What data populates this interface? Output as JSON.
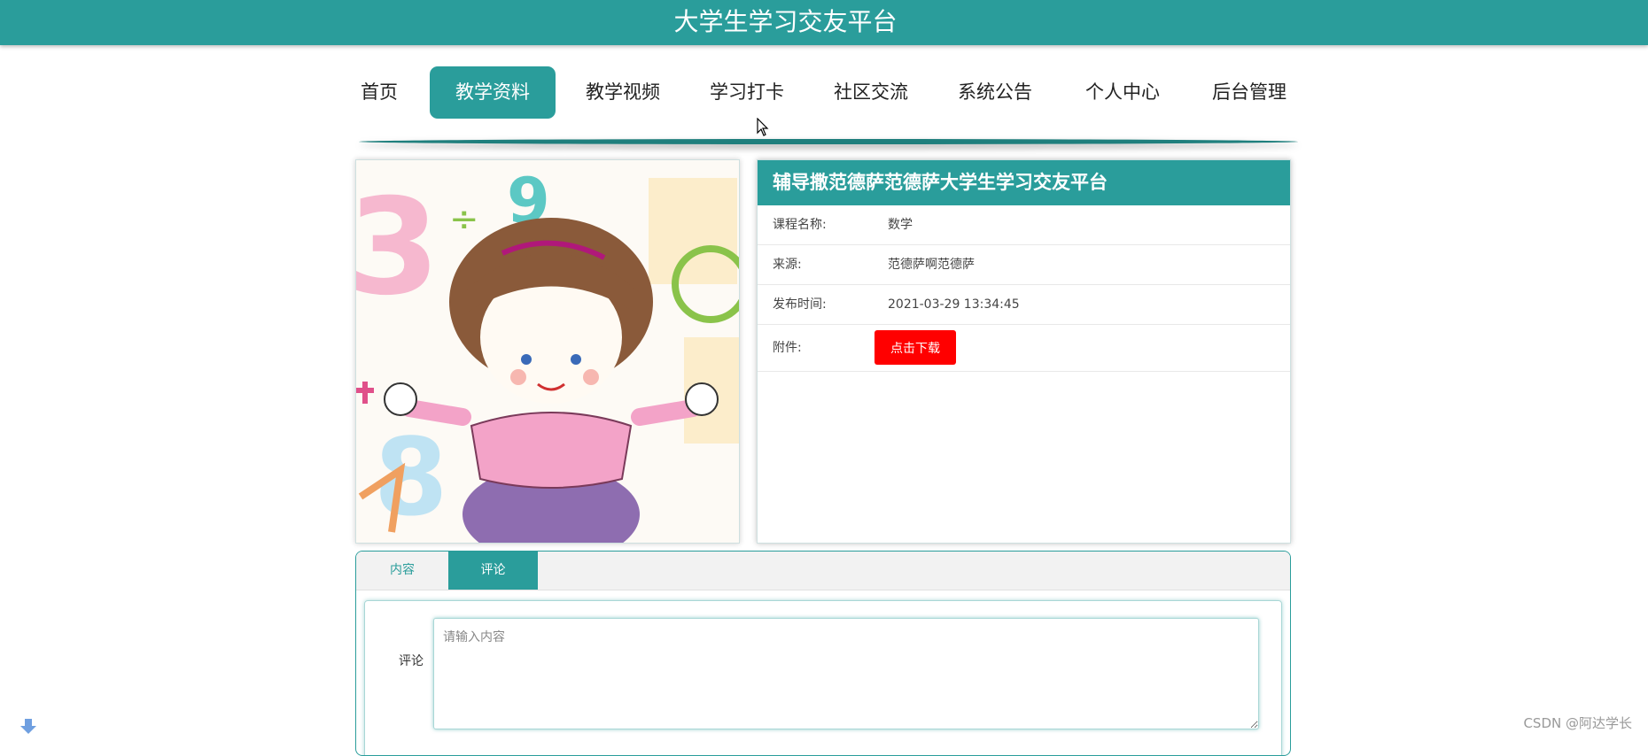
{
  "site": {
    "title": "大学生学习交友平台"
  },
  "nav": {
    "items": [
      {
        "label": "首页"
      },
      {
        "label": "教学资料"
      },
      {
        "label": "教学视频"
      },
      {
        "label": "学习打卡"
      },
      {
        "label": "社区交流"
      },
      {
        "label": "系统公告"
      },
      {
        "label": "个人中心"
      },
      {
        "label": "后台管理"
      }
    ],
    "active_item": "教学资料"
  },
  "detail": {
    "title": "辅导撒范德萨范德萨大学生学习交友平台",
    "rows": [
      {
        "label": "课程名称:",
        "value": "数学"
      },
      {
        "label": "来源:",
        "value": "范德萨啊范德萨"
      },
      {
        "label": "发布时间:",
        "value": "2021-03-29 13:34:45"
      }
    ],
    "attachment": {
      "label": "附件:",
      "button_label": "点击下载"
    }
  },
  "tabs": {
    "items": [
      {
        "label": "内容"
      },
      {
        "label": "评论"
      }
    ],
    "active_tab": "评论"
  },
  "comment": {
    "label": "评论",
    "value": "",
    "placeholder": "请输入内容"
  },
  "watermark": "CSDN @阿达学长",
  "colors": {
    "brand": "#2a9d9b",
    "download": "#ff0000"
  },
  "icons": {
    "scroll": "arrow-down-icon",
    "cursor": "mouse-cursor-icon"
  }
}
